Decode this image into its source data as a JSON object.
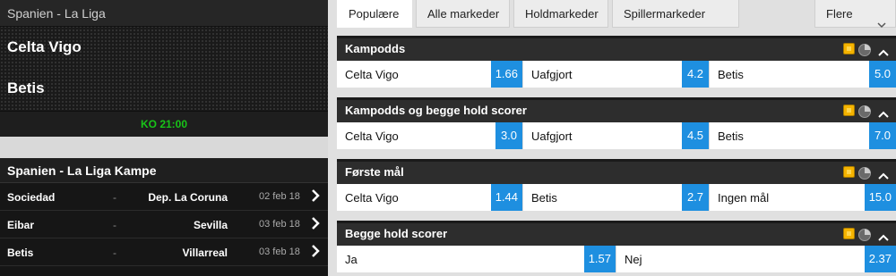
{
  "match": {
    "league": "Spanien - La Liga",
    "home": "Celta Vigo",
    "away": "Betis",
    "kickoff": "KO 21:00"
  },
  "fixtures": {
    "title": "Spanien - La Liga Kampe",
    "rows": [
      {
        "home": "Sociedad",
        "dash": "-",
        "away": "Dep. La Coruna",
        "date": "02 feb 18"
      },
      {
        "home": "Eibar",
        "dash": "-",
        "away": "Sevilla",
        "date": "03 feb 18"
      },
      {
        "home": "Betis",
        "dash": "-",
        "away": "Villarreal",
        "date": "03 feb 18"
      }
    ]
  },
  "tabs": [
    "Populære",
    "Alle markeder",
    "Holdmarkeder",
    "Spillermarkeder"
  ],
  "tab_more": "Flere",
  "markets": [
    {
      "title": "Kampodds",
      "selections": [
        {
          "label": "Celta Vigo",
          "odds": "1.66"
        },
        {
          "label": "Uafgjort",
          "odds": "4.2"
        },
        {
          "label": "Betis",
          "odds": "5.0"
        }
      ]
    },
    {
      "title": "Kampodds og begge hold scorer",
      "selections": [
        {
          "label": "Celta Vigo",
          "odds": "3.0"
        },
        {
          "label": "Uafgjort",
          "odds": "4.5"
        },
        {
          "label": "Betis",
          "odds": "7.0"
        }
      ]
    },
    {
      "title": "Første mål",
      "selections": [
        {
          "label": "Celta Vigo",
          "odds": "1.44"
        },
        {
          "label": "Betis",
          "odds": "2.7"
        },
        {
          "label": "Ingen mål",
          "odds": "15.0"
        }
      ]
    },
    {
      "title": "Begge hold scorer",
      "selections": [
        {
          "label": "Ja",
          "odds": "1.57"
        },
        {
          "label": "Nej",
          "odds": "2.37"
        }
      ]
    }
  ],
  "colors": {
    "odds_bg": "#1e8fe0",
    "kickoff": "#18c418",
    "live_icon": "#f5b400"
  },
  "icons": {
    "fixture_chevron": "chevron-right-icon",
    "live": "live-stream-icon",
    "stats": "stats-icon",
    "collapse": "chevron-up-icon",
    "more": "chevron-down-icon"
  }
}
